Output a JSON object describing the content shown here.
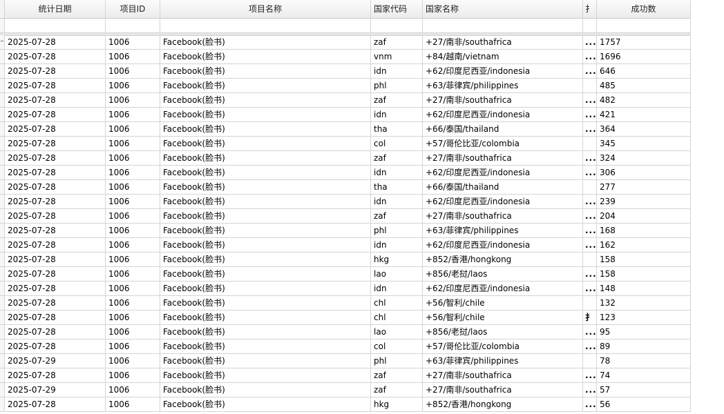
{
  "columns": [
    "统计日期",
    "项目ID",
    "项目名称",
    "国家代码",
    "国家名称",
    "扌",
    "成功数"
  ],
  "rows": [
    {
      "date": "2025-07-28",
      "pid": "1006",
      "pname": "Facebook(脸书)",
      "code": "zaf",
      "country": "+27/南非/southafrica",
      "more": "...",
      "success": "1757"
    },
    {
      "date": "2025-07-28",
      "pid": "1006",
      "pname": "Facebook(脸书)",
      "code": "vnm",
      "country": "+84/越南/vietnam",
      "more": "...",
      "success": "1696"
    },
    {
      "date": "2025-07-28",
      "pid": "1006",
      "pname": "Facebook(脸书)",
      "code": "idn",
      "country": "+62/印度尼西亚/indonesia",
      "more": "...",
      "success": "646"
    },
    {
      "date": "2025-07-28",
      "pid": "1006",
      "pname": "Facebook(脸书)",
      "code": "phl",
      "country": "+63/菲律宾/philippines",
      "more": "",
      "success": "485"
    },
    {
      "date": "2025-07-28",
      "pid": "1006",
      "pname": "Facebook(脸书)",
      "code": "zaf",
      "country": "+27/南非/southafrica",
      "more": "...",
      "success": "482"
    },
    {
      "date": "2025-07-28",
      "pid": "1006",
      "pname": "Facebook(脸书)",
      "code": "idn",
      "country": "+62/印度尼西亚/indonesia",
      "more": "...",
      "success": "421"
    },
    {
      "date": "2025-07-28",
      "pid": "1006",
      "pname": "Facebook(脸书)",
      "code": "tha",
      "country": "+66/泰国/thailand",
      "more": "...",
      "success": "364"
    },
    {
      "date": "2025-07-28",
      "pid": "1006",
      "pname": "Facebook(脸书)",
      "code": "col",
      "country": "+57/哥伦比亚/colombia",
      "more": "",
      "success": "345"
    },
    {
      "date": "2025-07-28",
      "pid": "1006",
      "pname": "Facebook(脸书)",
      "code": "zaf",
      "country": "+27/南非/southafrica",
      "more": "...",
      "success": "324"
    },
    {
      "date": "2025-07-28",
      "pid": "1006",
      "pname": "Facebook(脸书)",
      "code": "idn",
      "country": "+62/印度尼西亚/indonesia",
      "more": "...",
      "success": "306"
    },
    {
      "date": "2025-07-28",
      "pid": "1006",
      "pname": "Facebook(脸书)",
      "code": "tha",
      "country": "+66/泰国/thailand",
      "more": "",
      "success": "277"
    },
    {
      "date": "2025-07-28",
      "pid": "1006",
      "pname": "Facebook(脸书)",
      "code": "idn",
      "country": "+62/印度尼西亚/indonesia",
      "more": "...",
      "success": "239"
    },
    {
      "date": "2025-07-28",
      "pid": "1006",
      "pname": "Facebook(脸书)",
      "code": "zaf",
      "country": "+27/南非/southafrica",
      "more": "...",
      "success": "204"
    },
    {
      "date": "2025-07-28",
      "pid": "1006",
      "pname": "Facebook(脸书)",
      "code": "phl",
      "country": "+63/菲律宾/philippines",
      "more": "...",
      "success": "168"
    },
    {
      "date": "2025-07-28",
      "pid": "1006",
      "pname": "Facebook(脸书)",
      "code": "idn",
      "country": "+62/印度尼西亚/indonesia",
      "more": "...",
      "success": "162"
    },
    {
      "date": "2025-07-28",
      "pid": "1006",
      "pname": "Facebook(脸书)",
      "code": "hkg",
      "country": "+852/香港/hongkong",
      "more": "",
      "success": "158"
    },
    {
      "date": "2025-07-28",
      "pid": "1006",
      "pname": "Facebook(脸书)",
      "code": "lao",
      "country": "+856/老挝/laos",
      "more": "...",
      "success": "158"
    },
    {
      "date": "2025-07-28",
      "pid": "1006",
      "pname": "Facebook(脸书)",
      "code": "idn",
      "country": "+62/印度尼西亚/indonesia",
      "more": "...",
      "success": "148"
    },
    {
      "date": "2025-07-28",
      "pid": "1006",
      "pname": "Facebook(脸书)",
      "code": "chl",
      "country": "+56/智利/chile",
      "more": "",
      "success": "132"
    },
    {
      "date": "2025-07-28",
      "pid": "1006",
      "pname": "Facebook(脸书)",
      "code": "chl",
      "country": "+56/智利/chile",
      "more": "扌",
      "success": "123"
    },
    {
      "date": "2025-07-28",
      "pid": "1006",
      "pname": "Facebook(脸书)",
      "code": "lao",
      "country": "+856/老挝/laos",
      "more": "...",
      "success": "95"
    },
    {
      "date": "2025-07-28",
      "pid": "1006",
      "pname": "Facebook(脸书)",
      "code": "col",
      "country": "+57/哥伦比亚/colombia",
      "more": "...",
      "success": "89"
    },
    {
      "date": "2025-07-29",
      "pid": "1006",
      "pname": "Facebook(脸书)",
      "code": "phl",
      "country": "+63/菲律宾/philippines",
      "more": "",
      "success": "78"
    },
    {
      "date": "2025-07-28",
      "pid": "1006",
      "pname": "Facebook(脸书)",
      "code": "zaf",
      "country": "+27/南非/southafrica",
      "more": "...",
      "success": "74"
    },
    {
      "date": "2025-07-29",
      "pid": "1006",
      "pname": "Facebook(脸书)",
      "code": "zaf",
      "country": "+27/南非/southafrica",
      "more": "...",
      "success": "57"
    },
    {
      "date": "2025-07-28",
      "pid": "1006",
      "pname": "Facebook(脸书)",
      "code": "hkg",
      "country": "+852/香港/hongkong",
      "more": "...",
      "success": "56"
    }
  ]
}
